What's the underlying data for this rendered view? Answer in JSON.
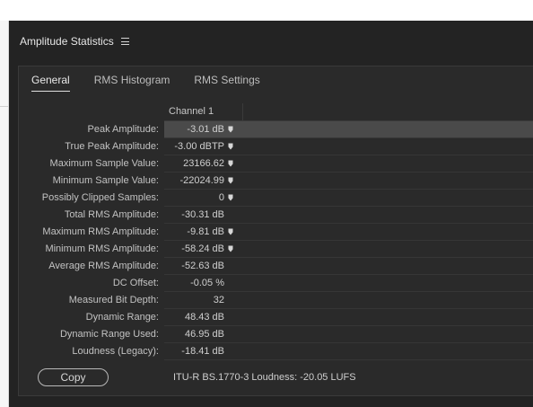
{
  "panel": {
    "title": "Amplitude Statistics"
  },
  "tabs": [
    {
      "label": "General",
      "active": true
    },
    {
      "label": "RMS Histogram",
      "active": false
    },
    {
      "label": "RMS Settings",
      "active": false
    }
  ],
  "table": {
    "column_header": "Channel 1",
    "rows": [
      {
        "label": "Peak Amplitude:",
        "value": "-3.01 dB",
        "marker": true,
        "highlight": true
      },
      {
        "label": "True Peak Amplitude:",
        "value": "-3.00 dBTP",
        "marker": true
      },
      {
        "label": "Maximum Sample Value:",
        "value": "23166.62",
        "marker": true
      },
      {
        "label": "Minimum Sample Value:",
        "value": "-22024.99",
        "marker": true
      },
      {
        "label": "Possibly Clipped Samples:",
        "value": "0",
        "marker": true
      },
      {
        "label": "Total RMS Amplitude:",
        "value": "-30.31 dB",
        "marker": false
      },
      {
        "label": "Maximum RMS Amplitude:",
        "value": "-9.81 dB",
        "marker": true
      },
      {
        "label": "Minimum RMS Amplitude:",
        "value": "-58.24 dB",
        "marker": true
      },
      {
        "label": "Average RMS Amplitude:",
        "value": "-52.63 dB",
        "marker": false
      },
      {
        "label": "DC Offset:",
        "value": "-0.05 %",
        "marker": false
      },
      {
        "label": "Measured Bit Depth:",
        "value": "32",
        "marker": false
      },
      {
        "label": "Dynamic Range:",
        "value": "48.43 dB",
        "marker": false
      },
      {
        "label": "Dynamic Range Used:",
        "value": "46.95 dB",
        "marker": false
      },
      {
        "label": "Loudness (Legacy):",
        "value": "-18.41 dB",
        "marker": false
      }
    ]
  },
  "footer": {
    "copy_label": "Copy",
    "loudness_text": "ITU-R BS.1770-3 Loudness:  -20.05 LUFS"
  },
  "icons": {
    "menu": "hamburger-icon",
    "marker": "marker-icon"
  },
  "colors": {
    "panel_bg": "#232323",
    "inner_bg": "#2a2a2a",
    "highlight_row": "#4a4a4a"
  }
}
